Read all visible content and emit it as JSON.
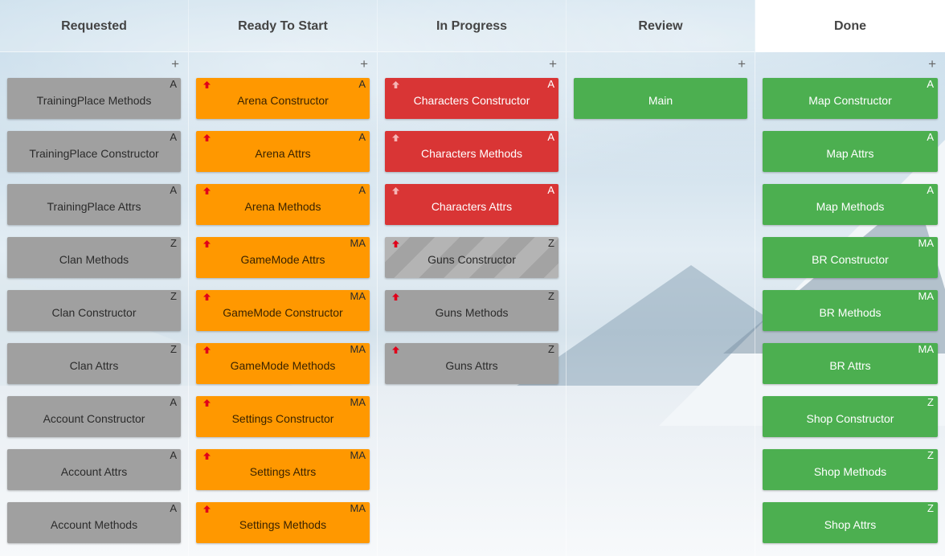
{
  "colors": {
    "grey": "#a0a0a0",
    "orange": "#ff9800",
    "red": "#d93535",
    "green": "#4caf50",
    "priority_arrow": "#e0001a",
    "priority_arrow_light": "#f5b5b5"
  },
  "add_icon": "plus-icon",
  "priority_icon": "arrow-up-icon",
  "add_label": "+",
  "columns": [
    {
      "title": "Requested",
      "cards": [
        {
          "label": "TrainingPlace Methods",
          "badge": "A",
          "color": "grey",
          "priority": false
        },
        {
          "label": "TrainingPlace Constructor",
          "badge": "A",
          "color": "grey",
          "priority": false
        },
        {
          "label": "TrainingPlace Attrs",
          "badge": "A",
          "color": "grey",
          "priority": false
        },
        {
          "label": "Clan Methods",
          "badge": "Z",
          "color": "grey",
          "priority": false
        },
        {
          "label": "Clan Constructor",
          "badge": "Z",
          "color": "grey",
          "priority": false
        },
        {
          "label": "Clan Attrs",
          "badge": "Z",
          "color": "grey",
          "priority": false
        },
        {
          "label": "Account Constructor",
          "badge": "A",
          "color": "grey",
          "priority": false
        },
        {
          "label": "Account Attrs",
          "badge": "A",
          "color": "grey",
          "priority": false
        },
        {
          "label": "Account Methods",
          "badge": "A",
          "color": "grey",
          "priority": false
        }
      ]
    },
    {
      "title": "Ready To Start",
      "cards": [
        {
          "label": "Arena Constructor",
          "badge": "A",
          "color": "orange",
          "priority": true
        },
        {
          "label": "Arena Attrs",
          "badge": "A",
          "color": "orange",
          "priority": true
        },
        {
          "label": "Arena Methods",
          "badge": "A",
          "color": "orange",
          "priority": true
        },
        {
          "label": "GameMode Attrs",
          "badge": "MA",
          "color": "orange",
          "priority": true
        },
        {
          "label": "GameMode Constructor",
          "badge": "MA",
          "color": "orange",
          "priority": true
        },
        {
          "label": "GameMode Methods",
          "badge": "MA",
          "color": "orange",
          "priority": true
        },
        {
          "label": "Settings Constructor",
          "badge": "MA",
          "color": "orange",
          "priority": true
        },
        {
          "label": "Settings Attrs",
          "badge": "MA",
          "color": "orange",
          "priority": true
        },
        {
          "label": "Settings Methods",
          "badge": "MA",
          "color": "orange",
          "priority": true
        }
      ]
    },
    {
      "title": "In Progress",
      "cards": [
        {
          "label": "Characters Constructor",
          "badge": "A",
          "color": "red",
          "priority": true
        },
        {
          "label": "Characters Methods",
          "badge": "A",
          "color": "red",
          "priority": true
        },
        {
          "label": "Characters Attrs",
          "badge": "A",
          "color": "red",
          "priority": true
        },
        {
          "label": "Guns Constructor",
          "badge": "Z",
          "color": "striped",
          "priority": true
        },
        {
          "label": "Guns Methods",
          "badge": "Z",
          "color": "grey",
          "priority": true
        },
        {
          "label": "Guns Attrs",
          "badge": "Z",
          "color": "grey",
          "priority": true
        }
      ]
    },
    {
      "title": "Review",
      "cards": [
        {
          "label": "Main",
          "badge": "",
          "color": "green",
          "priority": false
        }
      ]
    },
    {
      "title": "Done",
      "cards": [
        {
          "label": "Map Constructor",
          "badge": "A",
          "color": "green",
          "priority": false
        },
        {
          "label": "Map Attrs",
          "badge": "A",
          "color": "green",
          "priority": false
        },
        {
          "label": "Map Methods",
          "badge": "A",
          "color": "green",
          "priority": false
        },
        {
          "label": "BR Constructor",
          "badge": "MA",
          "color": "green",
          "priority": false
        },
        {
          "label": "BR Methods",
          "badge": "MA",
          "color": "green",
          "priority": false
        },
        {
          "label": "BR Attrs",
          "badge": "MA",
          "color": "green",
          "priority": false
        },
        {
          "label": "Shop Constructor",
          "badge": "Z",
          "color": "green",
          "priority": false
        },
        {
          "label": "Shop Methods",
          "badge": "Z",
          "color": "green",
          "priority": false
        },
        {
          "label": "Shop Attrs",
          "badge": "Z",
          "color": "green",
          "priority": false
        }
      ]
    }
  ]
}
